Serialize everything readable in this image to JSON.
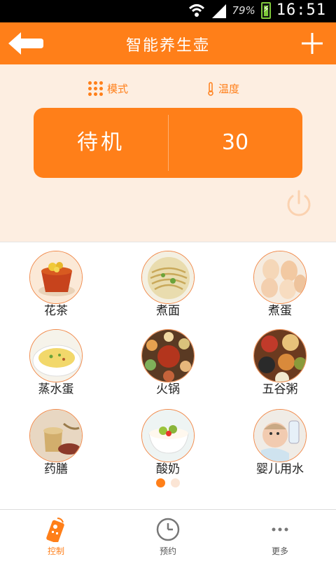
{
  "status_bar": {
    "battery_percent": "79%",
    "time": "16:51"
  },
  "app_bar": {
    "title": "智能养生壶",
    "back_icon": "back-arrow-icon",
    "add_icon": "plus-icon"
  },
  "control": {
    "mode_tab": {
      "label": "模式",
      "icon": "grid-dots-icon"
    },
    "temp_tab": {
      "label": "温度",
      "icon": "thermometer-icon"
    },
    "mode_value": "待机",
    "temp_value": "30",
    "power_icon": "power-icon"
  },
  "recipes": [
    {
      "label": "花茶",
      "icon": "flower-tea-icon"
    },
    {
      "label": "煮面",
      "icon": "noodles-icon"
    },
    {
      "label": "煮蛋",
      "icon": "eggs-icon"
    },
    {
      "label": "蒸水蛋",
      "icon": "steamed-egg-icon"
    },
    {
      "label": "火锅",
      "icon": "hotpot-icon"
    },
    {
      "label": "五谷粥",
      "icon": "grains-icon"
    },
    {
      "label": "药膳",
      "icon": "herbal-soup-icon"
    },
    {
      "label": "酸奶",
      "icon": "yogurt-icon"
    },
    {
      "label": "婴儿用水",
      "icon": "baby-water-icon"
    }
  ],
  "pager": {
    "pages": 2,
    "current": 1
  },
  "bottom_nav": [
    {
      "label": "控制",
      "icon": "remote-control-icon",
      "active": true
    },
    {
      "label": "预约",
      "icon": "clock-icon",
      "active": false
    },
    {
      "label": "更多",
      "icon": "more-dots-icon",
      "active": false
    }
  ],
  "colors": {
    "accent": "#ff7f19",
    "panel_bg": "#fdeee1"
  }
}
